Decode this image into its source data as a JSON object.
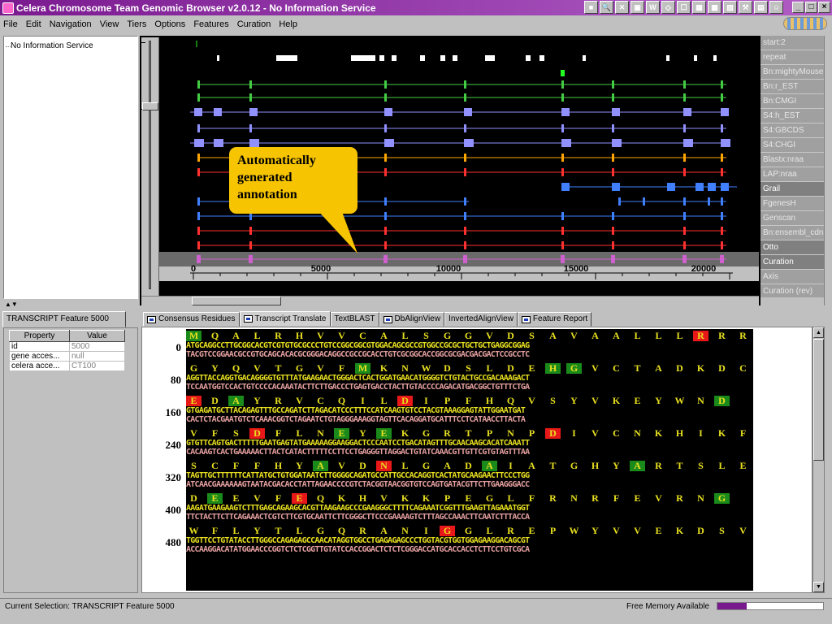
{
  "window": {
    "title": "Celera Chromosome Team Genomic Browser v2.0.12 - No Information Service"
  },
  "toolbar_icons": [
    "flag-icon",
    "search-icon",
    "compare-icon",
    "window-icon",
    "word-icon",
    "diamond-icon",
    "bookmark-icon",
    "grid-icon",
    "image-icon",
    "image2-icon",
    "tools-icon",
    "print-icon",
    "people-icon"
  ],
  "menu": [
    "File",
    "Edit",
    "Navigation",
    "View",
    "Tiers",
    "Options",
    "Features",
    "Curation",
    "Help"
  ],
  "tree": {
    "root": "No Information Service"
  },
  "tiers": [
    "start:2",
    "repeat",
    "Bn:mightyMouse",
    "Bn:r_EST",
    "Bn:CMGI",
    "S4:h_EST",
    "S4:GBCDS",
    "S4:CHGI",
    "Blastx:nraa",
    "LAP:nraa",
    "Grail",
    "FgenesH",
    "Genscan",
    "Bn:ensembl_cdna",
    "Otto",
    "Curation",
    "Axis",
    "Curation (rev)"
  ],
  "axis": {
    "ticks": [
      "0",
      "5000",
      "10000",
      "15000",
      "20000"
    ]
  },
  "callout": {
    "text": "Automatically generated annotation"
  },
  "feature_panel": {
    "tab": "TRANSCRIPT Feature 5000",
    "headers": [
      "Property",
      "Value"
    ],
    "rows": [
      {
        "property": "id",
        "value": "5000"
      },
      {
        "property": "gene acces...",
        "value": "null"
      },
      {
        "property": "celera acce...",
        "value": "CT100"
      }
    ]
  },
  "tabs": [
    {
      "label": "Consensus Residues",
      "icon": true
    },
    {
      "label": "Transcript Translate",
      "icon": true,
      "active": true
    },
    {
      "label": "TextBLAST",
      "icon": false
    },
    {
      "label": "DbAlignView",
      "icon": true
    },
    {
      "label": "InvertedAlignView",
      "icon": false
    },
    {
      "label": "Feature Report",
      "icon": true
    }
  ],
  "sequence": [
    {
      "pos": "0",
      "aa": "M Q A L R H V V C A L S G G V D S A V A A L L L R R R",
      "marks": {
        "0": "g",
        "24": "r"
      },
      "top": "ATGCAGGCCTTGCGGCACGTCGTGTGCGCCCTGTCCGGCGGCGTGGACAGCGCCGTGGCCGCGCTGCTGCTGAGGCGGAG",
      "bot": "TACGTCCGGAACGCCGTGCAGCACACGCGGGACAGGCCGCCGCACCTGTCGCGGCACCGGCGCGACGACGACTCCGCCTC"
    },
    {
      "pos": "80",
      "aa": "G Y Q V T G V F M K N W D S L D E H G V C T A D K D C",
      "marks": {
        "8": "g",
        "17": "g",
        "18": "g"
      },
      "top": "AGGTTACCAGGTGACAGGGGTGTTTATGAAGAACTGGGACTCACTGGATGAACATGGGGTCTGTACTGCCGACAAAGACT",
      "bot": "TCCAATGGTCCACTGTCCCCACAAATACTTCTTGACCCTGAGTGACCTACTTGTACCCCAGACATGACGGCTGTTTCTGA"
    },
    {
      "pos": "160",
      "aa": "E D A Y R V C Q I L D I P F H Q V S Y V K E Y W N D",
      "marks": {
        "0": "r",
        "2": "g",
        "10": "r",
        "25": "g"
      },
      "top": "GTGAGATGCTTACAGAGTTTGCCAGATCTTAGACATCCCTTTCCATCAAGTGTCCTACGTAAAGGAGTATTGGAATGAT",
      "bot": "CACTCTACGAATGTCTCAAACGGTCTAGAATCTGTAGGGAAAGGTAGTTCACAGGATGCATTTCCTCATAACCTTACTA"
    },
    {
      "pos": "240",
      "aa": "V F S D F L N E Y E K G R T P N P D I V C N K H I K F",
      "marks": {
        "3": "r",
        "7": "g",
        "9": "g",
        "17": "r"
      },
      "top": "GTGTTCAGTGACTTTTTGAATGAGTATGAAAAAGGAAGGACTCCCAATCCTGACATAGTTTGCAACAAGCACATCAAATT",
      "bot": "CACAAGTCACTGAAAAACTTACTCATACTTTTTCCTTCCTGAGGGTTAGGACTGTATCAAACGTTGTTCGTGTAGTTTAA"
    },
    {
      "pos": "320",
      "aa": "S C F F H Y A V D N L G A D A I A T G H Y A R T S L E",
      "marks": {
        "6": "g",
        "9": "r",
        "14": "g",
        "21": "g"
      },
      "top": "TAGTTGCTTTTTTCATTATGCTGTGGATAATCTTGGGGCAGATGCCATTGCCACAGGTCACTATGCAAGAACTTCCCTGG",
      "bot": "ATCAACGAAAAAAGTAATACGACACCTATTAGAACCCCGTCTACGGTAACGGTGTCCAGTGATACGTTCTTGAAGGGACC"
    },
    {
      "pos": "400",
      "aa": "D E E V F E Q K H V K K P E G L F R N R F E V R N G",
      "marks": {
        "1": "g",
        "5": "r",
        "25": "g"
      },
      "top": "AAGATGAAGAAGTCTTTGAGCAGAAGCACGTTAAGAAGCCCGAAGGGCTTTTCAGAAATCGGTTTGAAGTTAGAAATGGT",
      "bot": "TTCTACTTCTTCAGAAACTCGTCTTCGTGCAATTCTTCGGGCTTCCCGAAAAGTCTTTAGCCAAACTTCAATCTTTACCA"
    },
    {
      "pos": "480",
      "aa": "W F L Y T L G Q R A N I G G L R E P W Y V V E K D S V",
      "marks": {
        "12": "r"
      },
      "top": "TGGTTCCTGTATACCTTGGGCCAGAGAGCCAACATAGGTGGCCTGAGAGAGCCCTGGTACGTGGTGGAGAAGGACAGCGT",
      "bot": "ACCAAGGACATATGGAACCCGGTCTCTCGGTTGTATCCACCGGACTCTCTCGGGACCATGCACCACCTCTTCCTGTCGCA"
    }
  ],
  "status": {
    "selection": "Current Selection: TRANSCRIPT Feature 5000",
    "memory_label": "Free Memory Available",
    "memory_fraction": 0.28
  },
  "colors": {
    "title_bar": "#7a1a8f",
    "callout": "#f6c400",
    "aa_text": "#e8e020",
    "match": "#1a8a1a",
    "stop": "#e81818"
  }
}
